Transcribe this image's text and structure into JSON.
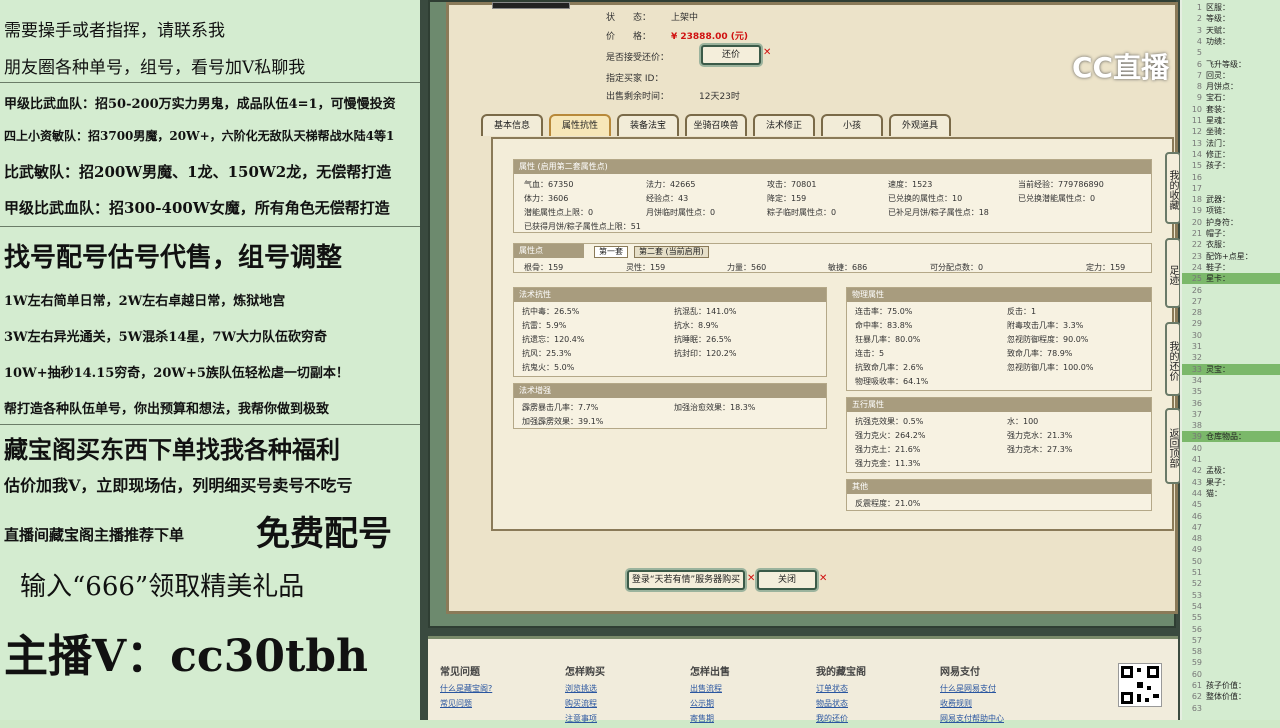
{
  "left_overlay": {
    "lines": [
      "需要操手或者指挥，请联系我",
      "朋友圈各种单号，组号，看号加Ⅴ私聊我",
      "甲级比武血队：招50-200万实力男鬼，成品队伍4=1，可慢慢投资",
      "四上小资敏队：招3700男魔，20W+，六阶化无敌队天梯帮战水陆4等1",
      "比武敏队：招200W男魔、1龙、150W2龙，无偿帮打造",
      "甲级比武血队：招300-400W女魔，所有角色无偿帮打造",
      "找号配号估号代售，组号调整",
      "1W左右简单日常，2W左右卓越日常，炼狱地宫",
      "3W左右异光通关，5W混杀14星，7W大力队伍砍穷奇",
      "10W+抽秒14.15穷奇，20W+5族队伍轻松虐一切副本！",
      "帮打造各种队伍单号，你出预算和想法，我帮你做到极致",
      "藏宝阁买东西下单找我各种福利",
      "估价加我V，立即现场估，列明细买号卖号不吃亏",
      "直播间藏宝阁主播推荐下单",
      "免费配号",
      "输入“666”领取精美礼品",
      "主播V：cc30tbh"
    ]
  },
  "item": {
    "status_label": "状　　态：",
    "status_value": "上架中",
    "price_label": "价　　格：",
    "price_value": "¥ 23888.00 (元)",
    "bargain_label": "是否接受还价：",
    "bargain_button": "还价",
    "buyer_label": "指定买家 ID：",
    "remaining_label": "出售剩余时间：",
    "remaining_value": "12天23时"
  },
  "tabs": [
    "基本信息",
    "属性抗性",
    "装备法宝",
    "坐骑召唤兽",
    "法术修正",
    "小孩",
    "外观道具"
  ],
  "attr": {
    "header": "属性 (启用第二套属性点)",
    "rows": [
      [
        "气血：67350",
        "法力：42665",
        "攻击：70801",
        "速度：1523",
        "当前经验：779786890"
      ],
      [
        "体力：3606",
        "经验点：43",
        "降定：159",
        "已兑换的属性点：10",
        "已兑换潜能属性点：0"
      ],
      [
        "潜能属性点上限：0",
        "月饼临时属性点：0",
        "粽子临时属性点：0",
        "已补足月饼/粽子属性点：18",
        ""
      ]
    ],
    "note": "已获得月饼/粽子属性点上限：51"
  },
  "points": {
    "header": "属性点",
    "subtab1": "第一套",
    "subtab2": "第二套 (当前启用)",
    "values": [
      "根骨：159",
      "灵性：159",
      "力量：560",
      "敏捷：686",
      "可分配点数：0",
      "定力：159"
    ]
  },
  "resist": {
    "header": "法术抗性",
    "cells": [
      "抗中毒：26.5%",
      "抗混乱：141.0%",
      "抗雷：5.9%",
      "抗水：8.9%",
      "抗遗忘：120.4%",
      "抗睡眠：26.5%",
      "抗风：25.3%",
      "抗封印：120.2%",
      "抗鬼火：5.0%",
      ""
    ]
  },
  "boost": {
    "header": "法术增强",
    "cells": [
      "霹雳暴击几率：7.7%",
      "加强治愈效果：18.3%",
      "加强霹雳效果：39.1%",
      ""
    ]
  },
  "physical": {
    "header": "物理属性",
    "cells": [
      "连击率：75.0%",
      "反击：1",
      "命中率：83.8%",
      "附毒攻击几率：3.3%",
      "狂暴几率：80.0%",
      "忽视防御程度：90.0%",
      "连击：5",
      "致命几率：78.9%",
      "抗致命几率：2.6%",
      "忽视防御几率：100.0%",
      "物理吸收率：64.1%",
      ""
    ]
  },
  "five": {
    "header": "五行属性",
    "cells": [
      "抗强克效果：0.5%",
      "水：100",
      "强力克火：264.2%",
      "强力克水：21.3%",
      "强力克土：21.6%",
      "强力克木：27.3%",
      "强力克金：11.3%",
      ""
    ]
  },
  "other": {
    "header": "其他",
    "cells": [
      "反震程度：21.0%"
    ]
  },
  "actions": {
    "login_button": "登录“天若有情”服务器购买",
    "close_button": "关闭"
  },
  "sidenav": [
    "我的收藏",
    "足迹",
    "我的还价",
    "返回顶部"
  ],
  "footer": {
    "cols": [
      {
        "title": "常见问题",
        "items": [
          "什么是藏宝阁?",
          "常见问题"
        ]
      },
      {
        "title": "怎样购买",
        "items": [
          "浏览挑选",
          "购买流程",
          "注意事项"
        ]
      },
      {
        "title": "怎样出售",
        "items": [
          "出售流程",
          "公示期",
          "寄售期"
        ]
      },
      {
        "title": "我的藏宝阁",
        "items": [
          "订单状态",
          "物品状态",
          "我的还价"
        ]
      },
      {
        "title": "网易支付",
        "items": [
          "什么是网易支付",
          "收费规则",
          "网易支付帮助中心"
        ]
      }
    ]
  },
  "logo": "CC直播",
  "right_panel": {
    "rows": [
      {
        "n": "1",
        "t": "区服："
      },
      {
        "n": "2",
        "t": "等级："
      },
      {
        "n": "3",
        "t": "天赋："
      },
      {
        "n": "4",
        "t": "功绩："
      },
      {
        "n": "5",
        "t": ""
      },
      {
        "n": "6",
        "t": "飞升等级："
      },
      {
        "n": "7",
        "t": "回灵："
      },
      {
        "n": "8",
        "t": "月饼点："
      },
      {
        "n": "9",
        "t": "宝石："
      },
      {
        "n": "10",
        "t": "套装："
      },
      {
        "n": "11",
        "t": "星魂："
      },
      {
        "n": "12",
        "t": "坐骑："
      },
      {
        "n": "13",
        "t": "法门："
      },
      {
        "n": "14",
        "t": "修正："
      },
      {
        "n": "15",
        "t": "孩子："
      },
      {
        "n": "16",
        "t": ""
      },
      {
        "n": "17",
        "t": ""
      },
      {
        "n": "18",
        "t": "武器："
      },
      {
        "n": "19",
        "t": "项链："
      },
      {
        "n": "20",
        "t": "护身符："
      },
      {
        "n": "21",
        "t": "帽子："
      },
      {
        "n": "22",
        "t": "衣服："
      },
      {
        "n": "23",
        "t": "配饰+点星："
      },
      {
        "n": "24",
        "t": "鞋子："
      },
      {
        "n": "25",
        "t": "星卡："
      },
      {
        "n": "26",
        "t": ""
      },
      {
        "n": "27",
        "t": ""
      },
      {
        "n": "28",
        "t": ""
      },
      {
        "n": "29",
        "t": ""
      },
      {
        "n": "30",
        "t": ""
      },
      {
        "n": "31",
        "t": ""
      },
      {
        "n": "32",
        "t": ""
      },
      {
        "n": "33",
        "t": "灵宝："
      },
      {
        "n": "34",
        "t": ""
      },
      {
        "n": "35",
        "t": ""
      },
      {
        "n": "36",
        "t": ""
      },
      {
        "n": "37",
        "t": ""
      },
      {
        "n": "38",
        "t": ""
      },
      {
        "n": "39",
        "t": "仓库物品："
      },
      {
        "n": "40",
        "t": ""
      },
      {
        "n": "41",
        "t": ""
      },
      {
        "n": "42",
        "t": "孟极："
      },
      {
        "n": "43",
        "t": "果子："
      },
      {
        "n": "44",
        "t": "猫："
      },
      {
        "n": "45",
        "t": ""
      },
      {
        "n": "46",
        "t": ""
      },
      {
        "n": "47",
        "t": ""
      },
      {
        "n": "48",
        "t": ""
      },
      {
        "n": "49",
        "t": ""
      },
      {
        "n": "50",
        "t": ""
      },
      {
        "n": "51",
        "t": ""
      },
      {
        "n": "52",
        "t": ""
      },
      {
        "n": "53",
        "t": ""
      },
      {
        "n": "54",
        "t": ""
      },
      {
        "n": "55",
        "t": ""
      },
      {
        "n": "56",
        "t": ""
      },
      {
        "n": "57",
        "t": ""
      },
      {
        "n": "58",
        "t": ""
      },
      {
        "n": "59",
        "t": ""
      },
      {
        "n": "60",
        "t": ""
      },
      {
        "n": "61",
        "t": "孩子价值："
      },
      {
        "n": "62",
        "t": "整体价值："
      },
      {
        "n": "63",
        "t": ""
      }
    ],
    "highlight_rows": [
      24,
      32,
      38
    ],
    "highlight_color": "#7bb86a"
  }
}
